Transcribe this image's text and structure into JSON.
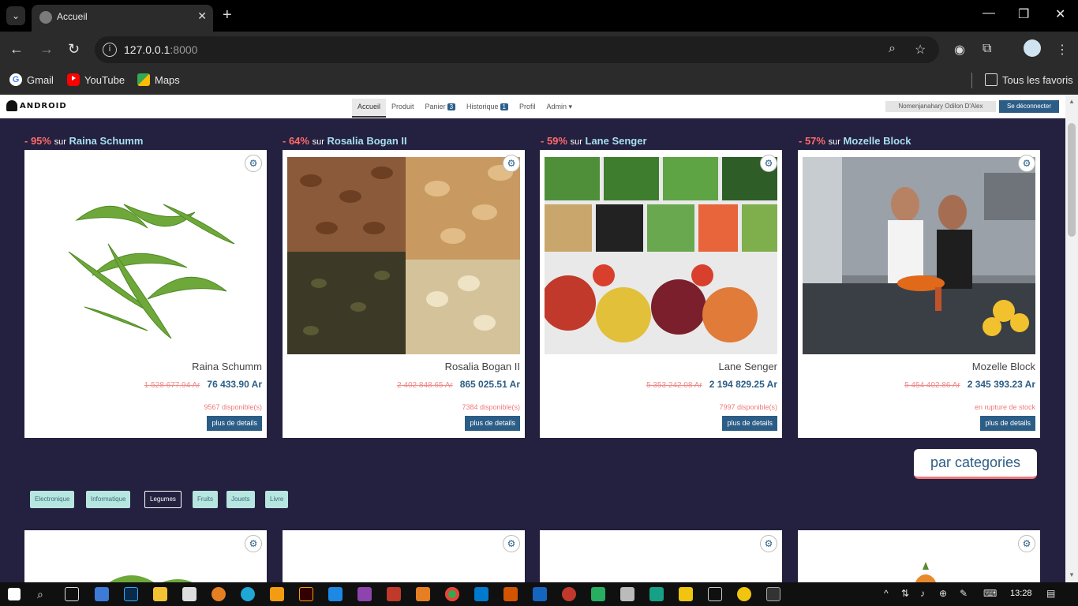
{
  "browser": {
    "tab_title": "Accueil",
    "url_host": "127.0.0.1",
    "url_port": ":8000",
    "bookmarks": [
      "Gmail",
      "YouTube",
      "Maps"
    ],
    "all_bookmarks": "Tous les favoris"
  },
  "site": {
    "logo_text": "ANDROID",
    "nav": [
      {
        "label": "Accueil"
      },
      {
        "label": "Produit"
      },
      {
        "label": "Panier",
        "badge": "3"
      },
      {
        "label": "Historique",
        "badge": "1"
      },
      {
        "label": "Profil"
      },
      {
        "label": "Admin ▾"
      }
    ],
    "user_name": "Nomenjanahary Odilon D'Alex",
    "logout_label": "Se déconnecter"
  },
  "deals": [
    {
      "discount": "- 95%",
      "sur": "sur",
      "product": "Raina Schumm",
      "name": "Raina Schumm",
      "old_price": "1 528 677.94 Ar",
      "new_price": "76 433.90 Ar",
      "stock": "9567 disponible(s)",
      "details_label": "plus de details"
    },
    {
      "discount": "- 64%",
      "sur": "sur",
      "product": "Rosalia Bogan II",
      "name": "Rosalia Bogan II",
      "old_price": "2 402 848.65 Ar",
      "new_price": "865 025.51 Ar",
      "stock": "7384 disponible(s)",
      "details_label": "plus de details"
    },
    {
      "discount": "- 59%",
      "sur": "sur",
      "product": "Lane Senger",
      "name": "Lane Senger",
      "old_price": "5 353 242.08 Ar",
      "new_price": "2 194 829.25 Ar",
      "stock": "7997 disponible(s)",
      "details_label": "plus de details"
    },
    {
      "discount": "- 57%",
      "sur": "sur",
      "product": "Mozelle Block",
      "name": "Mozelle Block",
      "old_price": "5 454 402.86 Ar",
      "new_price": "2 345 393.23 Ar",
      "stock": "en rupture de stock",
      "details_label": "plus de details"
    }
  ],
  "categories": {
    "heading": "par categories",
    "items": [
      "Electronique",
      "Informatique",
      "Legumes",
      "Fruits",
      "Jouets",
      "Livre"
    ],
    "selected": "Legumes"
  },
  "taskbar": {
    "time": "13:28"
  },
  "colors": {
    "page_bg": "#24203f",
    "accent_blue": "#2c5d86",
    "discount_red": "#ff6b6b",
    "title_cyan": "#a8dff0",
    "category_chip": "#b7e5e0"
  }
}
